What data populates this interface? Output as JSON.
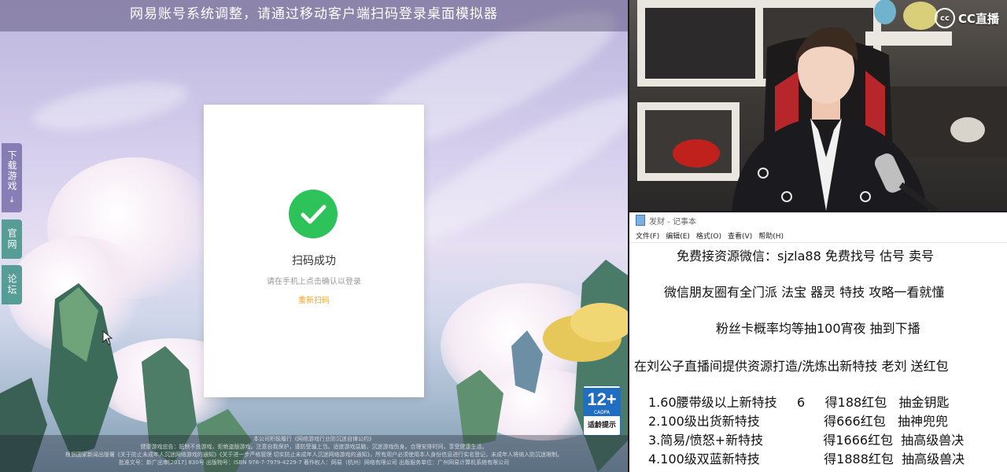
{
  "game": {
    "banner": "网易账号系统调整，请通过移动客户端扫码登录桌面模拟器",
    "side_tabs": [
      {
        "label": "下载游戏",
        "icon": "download-icon"
      },
      {
        "label": "官网"
      },
      {
        "label": "论坛"
      }
    ],
    "login_card": {
      "status_icon": "check-circle-icon",
      "title": "扫码成功",
      "subtitle": "请在手机上点击确认以登录",
      "rescan": "重新扫码"
    },
    "age_badge": {
      "rating": "12+",
      "org": "CADPA",
      "label": "适龄提示"
    },
    "footer_lines": [
      "本公司积极履行《网络游戏行业防沉迷自律公约》",
      "健康游戏忠告：抵制不良游戏，拒绝盗版游戏。注意自我保护，谨防受骗上当。适度游戏益脑，沉迷游戏伤身。合理安排时间，享受健康生活。",
      "根据国家新闻出版署《关于防止未成年人沉迷网络游戏的通知》《关于进一步严格管理 切实防止未成年人沉迷网络游戏的通知》，所有用户必须使用本人身份信息进行实名登记，未成年人将纳入防沉迷限制。",
      "批准文号：新广出审[2017] 830号 出版物号：ISBN 978-7-7979-4229-7 著作权人：网易（杭州）网络有限公司 出版服务单位：广州网易计算机系统有限公司"
    ]
  },
  "stream": {
    "logo": "CC直播",
    "logo_icon": "cc-logo-icon"
  },
  "notepad": {
    "title": "发财 - 记事本",
    "menu": [
      "文件(F)",
      "编辑(E)",
      "格式(O)",
      "查看(V)",
      "帮助(H)"
    ],
    "lines": [
      "免费接资源微信：sjzla88 免费找号 估号 卖号",
      "微信朋友圈有全门派 法宝 器灵 特技 攻略一看就懂",
      "粉丝卡概率均等抽100宵夜 抽到下播",
      "在刘公子直播间提供资源打造/洗炼出新特技 老刘 送红包",
      "1.60腰带级以上新特技     6     得188红包   抽金钥匙",
      "2.100级出货新特技                得666红包   抽神兜兜",
      "3.简易/愤怒+新特技               得1666红包  抽高级兽决",
      "4.100级双蓝新特技                得1888红包  抽高级兽决"
    ]
  }
}
